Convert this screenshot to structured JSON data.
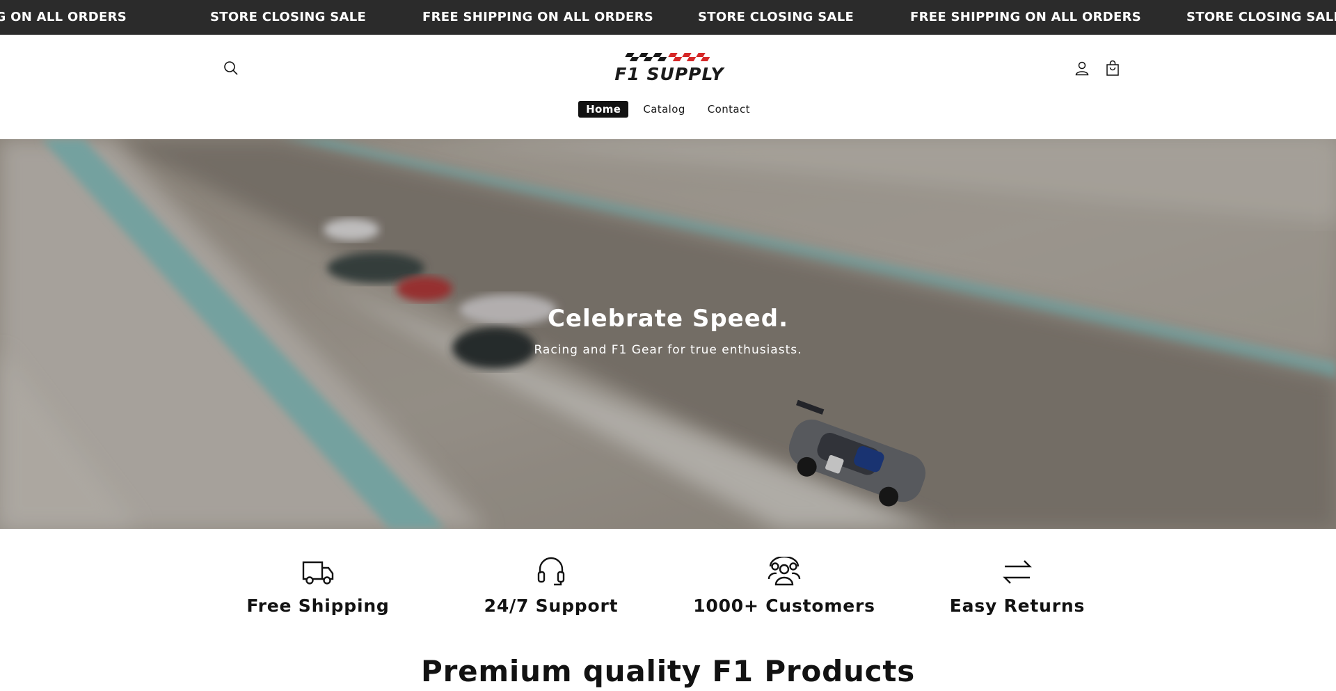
{
  "announcement": {
    "items": [
      "FREE SHIPPING ON ALL ORDERS",
      "STORE CLOSING SALE",
      "FREE SHIPPING ON ALL ORDERS",
      "STORE CLOSING SALE",
      "FREE SHIPPING ON ALL ORDERS",
      "STORE CLOSING SALE"
    ]
  },
  "header": {
    "logo_text": "F1 SUPPLY",
    "icons": {
      "search": "search-icon",
      "account": "account-icon",
      "cart": "cart-icon"
    },
    "nav": [
      {
        "label": "Home",
        "active": true
      },
      {
        "label": "Catalog",
        "active": false
      },
      {
        "label": "Contact",
        "active": false
      }
    ]
  },
  "hero": {
    "title": "Celebrate Speed.",
    "subtitle": "Racing and F1 Gear for true enthusiasts."
  },
  "features": [
    {
      "icon": "truck-icon",
      "label": "Free Shipping"
    },
    {
      "icon": "headset-icon",
      "label": "24/7 Support"
    },
    {
      "icon": "customers-icon",
      "label": "1000+ Customers"
    },
    {
      "icon": "return-arrows-icon",
      "label": "Easy Returns"
    }
  ],
  "section": {
    "title": "Premium quality F1 Products"
  },
  "colors": {
    "announcement_bg": "#2b2b2b",
    "text": "#121212",
    "logo_accent": "#d62828",
    "track_teal": "#8ec5c2"
  }
}
